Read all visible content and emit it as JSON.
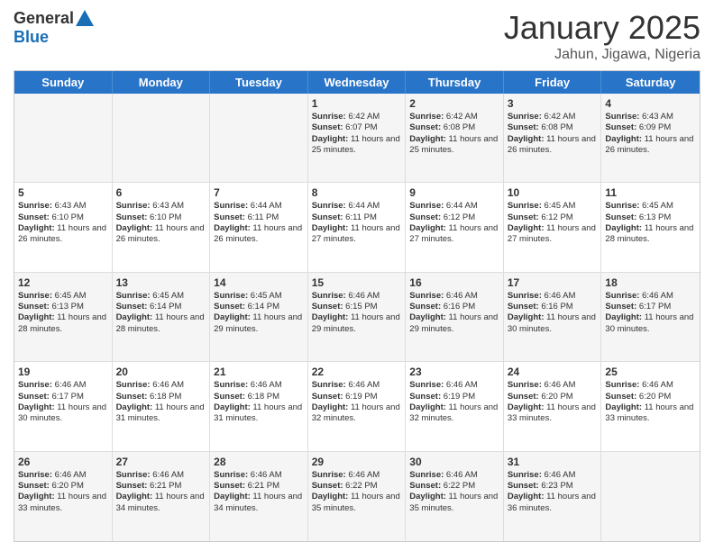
{
  "logo": {
    "general": "General",
    "blue": "Blue"
  },
  "title": "January 2025",
  "subtitle": "Jahun, Jigawa, Nigeria",
  "days": [
    "Sunday",
    "Monday",
    "Tuesday",
    "Wednesday",
    "Thursday",
    "Friday",
    "Saturday"
  ],
  "weeks": [
    [
      {
        "day": "",
        "text": ""
      },
      {
        "day": "",
        "text": ""
      },
      {
        "day": "",
        "text": ""
      },
      {
        "day": "1",
        "text": "Sunrise: 6:42 AM\nSunset: 6:07 PM\nDaylight: 11 hours and 25 minutes."
      },
      {
        "day": "2",
        "text": "Sunrise: 6:42 AM\nSunset: 6:08 PM\nDaylight: 11 hours and 25 minutes."
      },
      {
        "day": "3",
        "text": "Sunrise: 6:42 AM\nSunset: 6:08 PM\nDaylight: 11 hours and 26 minutes."
      },
      {
        "day": "4",
        "text": "Sunrise: 6:43 AM\nSunset: 6:09 PM\nDaylight: 11 hours and 26 minutes."
      }
    ],
    [
      {
        "day": "5",
        "text": "Sunrise: 6:43 AM\nSunset: 6:10 PM\nDaylight: 11 hours and 26 minutes."
      },
      {
        "day": "6",
        "text": "Sunrise: 6:43 AM\nSunset: 6:10 PM\nDaylight: 11 hours and 26 minutes."
      },
      {
        "day": "7",
        "text": "Sunrise: 6:44 AM\nSunset: 6:11 PM\nDaylight: 11 hours and 26 minutes."
      },
      {
        "day": "8",
        "text": "Sunrise: 6:44 AM\nSunset: 6:11 PM\nDaylight: 11 hours and 27 minutes."
      },
      {
        "day": "9",
        "text": "Sunrise: 6:44 AM\nSunset: 6:12 PM\nDaylight: 11 hours and 27 minutes."
      },
      {
        "day": "10",
        "text": "Sunrise: 6:45 AM\nSunset: 6:12 PM\nDaylight: 11 hours and 27 minutes."
      },
      {
        "day": "11",
        "text": "Sunrise: 6:45 AM\nSunset: 6:13 PM\nDaylight: 11 hours and 28 minutes."
      }
    ],
    [
      {
        "day": "12",
        "text": "Sunrise: 6:45 AM\nSunset: 6:13 PM\nDaylight: 11 hours and 28 minutes."
      },
      {
        "day": "13",
        "text": "Sunrise: 6:45 AM\nSunset: 6:14 PM\nDaylight: 11 hours and 28 minutes."
      },
      {
        "day": "14",
        "text": "Sunrise: 6:45 AM\nSunset: 6:14 PM\nDaylight: 11 hours and 29 minutes."
      },
      {
        "day": "15",
        "text": "Sunrise: 6:46 AM\nSunset: 6:15 PM\nDaylight: 11 hours and 29 minutes."
      },
      {
        "day": "16",
        "text": "Sunrise: 6:46 AM\nSunset: 6:16 PM\nDaylight: 11 hours and 29 minutes."
      },
      {
        "day": "17",
        "text": "Sunrise: 6:46 AM\nSunset: 6:16 PM\nDaylight: 11 hours and 30 minutes."
      },
      {
        "day": "18",
        "text": "Sunrise: 6:46 AM\nSunset: 6:17 PM\nDaylight: 11 hours and 30 minutes."
      }
    ],
    [
      {
        "day": "19",
        "text": "Sunrise: 6:46 AM\nSunset: 6:17 PM\nDaylight: 11 hours and 30 minutes."
      },
      {
        "day": "20",
        "text": "Sunrise: 6:46 AM\nSunset: 6:18 PM\nDaylight: 11 hours and 31 minutes."
      },
      {
        "day": "21",
        "text": "Sunrise: 6:46 AM\nSunset: 6:18 PM\nDaylight: 11 hours and 31 minutes."
      },
      {
        "day": "22",
        "text": "Sunrise: 6:46 AM\nSunset: 6:19 PM\nDaylight: 11 hours and 32 minutes."
      },
      {
        "day": "23",
        "text": "Sunrise: 6:46 AM\nSunset: 6:19 PM\nDaylight: 11 hours and 32 minutes."
      },
      {
        "day": "24",
        "text": "Sunrise: 6:46 AM\nSunset: 6:20 PM\nDaylight: 11 hours and 33 minutes."
      },
      {
        "day": "25",
        "text": "Sunrise: 6:46 AM\nSunset: 6:20 PM\nDaylight: 11 hours and 33 minutes."
      }
    ],
    [
      {
        "day": "26",
        "text": "Sunrise: 6:46 AM\nSunset: 6:20 PM\nDaylight: 11 hours and 33 minutes."
      },
      {
        "day": "27",
        "text": "Sunrise: 6:46 AM\nSunset: 6:21 PM\nDaylight: 11 hours and 34 minutes."
      },
      {
        "day": "28",
        "text": "Sunrise: 6:46 AM\nSunset: 6:21 PM\nDaylight: 11 hours and 34 minutes."
      },
      {
        "day": "29",
        "text": "Sunrise: 6:46 AM\nSunset: 6:22 PM\nDaylight: 11 hours and 35 minutes."
      },
      {
        "day": "30",
        "text": "Sunrise: 6:46 AM\nSunset: 6:22 PM\nDaylight: 11 hours and 35 minutes."
      },
      {
        "day": "31",
        "text": "Sunrise: 6:46 AM\nSunset: 6:23 PM\nDaylight: 11 hours and 36 minutes."
      },
      {
        "day": "",
        "text": ""
      }
    ]
  ],
  "shaded_rows": [
    0,
    2,
    4
  ]
}
